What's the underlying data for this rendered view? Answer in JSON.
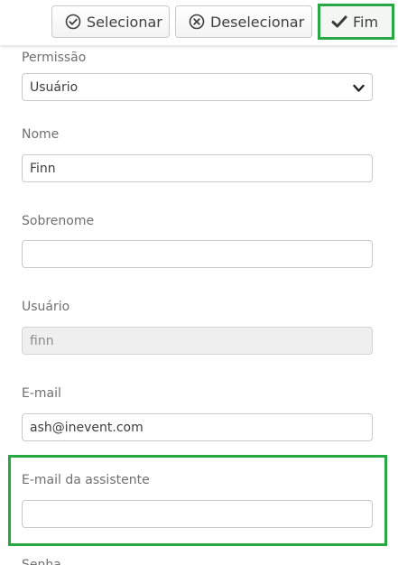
{
  "toolbar": {
    "select_label": "Selecionar",
    "deselect_label": "Deselecionar",
    "finish_label": "Fim"
  },
  "form": {
    "permission": {
      "label": "Permissão",
      "value": "Usuário"
    },
    "first_name": {
      "label": "Nome",
      "value": "Finn"
    },
    "last_name": {
      "label": "Sobrenome",
      "value": ""
    },
    "username": {
      "label": "Usuário",
      "value": "finn"
    },
    "email": {
      "label": "E-mail",
      "value": "ash@inevent.com"
    },
    "assistant_email": {
      "label": "E-mail da assistente",
      "value": ""
    },
    "next_label_partial": "Senha"
  },
  "colors": {
    "highlight": "#28a745"
  },
  "icons": [
    "check-circle-icon",
    "x-circle-icon",
    "checkmark-icon",
    "chevron-down-icon"
  ]
}
